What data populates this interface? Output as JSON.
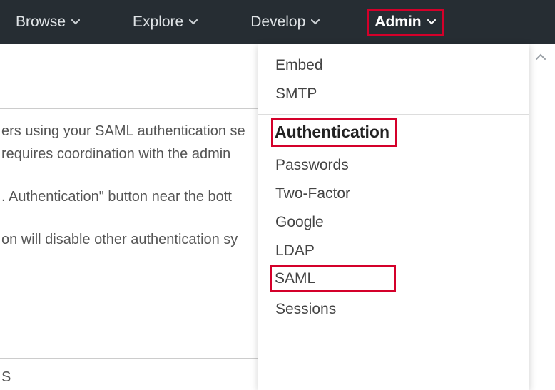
{
  "nav": {
    "browse": "Browse",
    "explore": "Explore",
    "develop": "Develop",
    "admin": "Admin"
  },
  "bg": {
    "line1": "ers using your SAML authentication se",
    "line2": " requires coordination with the admin",
    "line3": ". Authentication\" button near the bott",
    "line4": "on will disable other authentication sy",
    "s": "S"
  },
  "dropdown": {
    "embed": "Embed",
    "smtp": "SMTP",
    "authentication": "Authentication",
    "passwords": "Passwords",
    "twofactor": "Two-Factor",
    "google": "Google",
    "ldap": "LDAP",
    "saml": "SAML",
    "sessions": "Sessions"
  }
}
